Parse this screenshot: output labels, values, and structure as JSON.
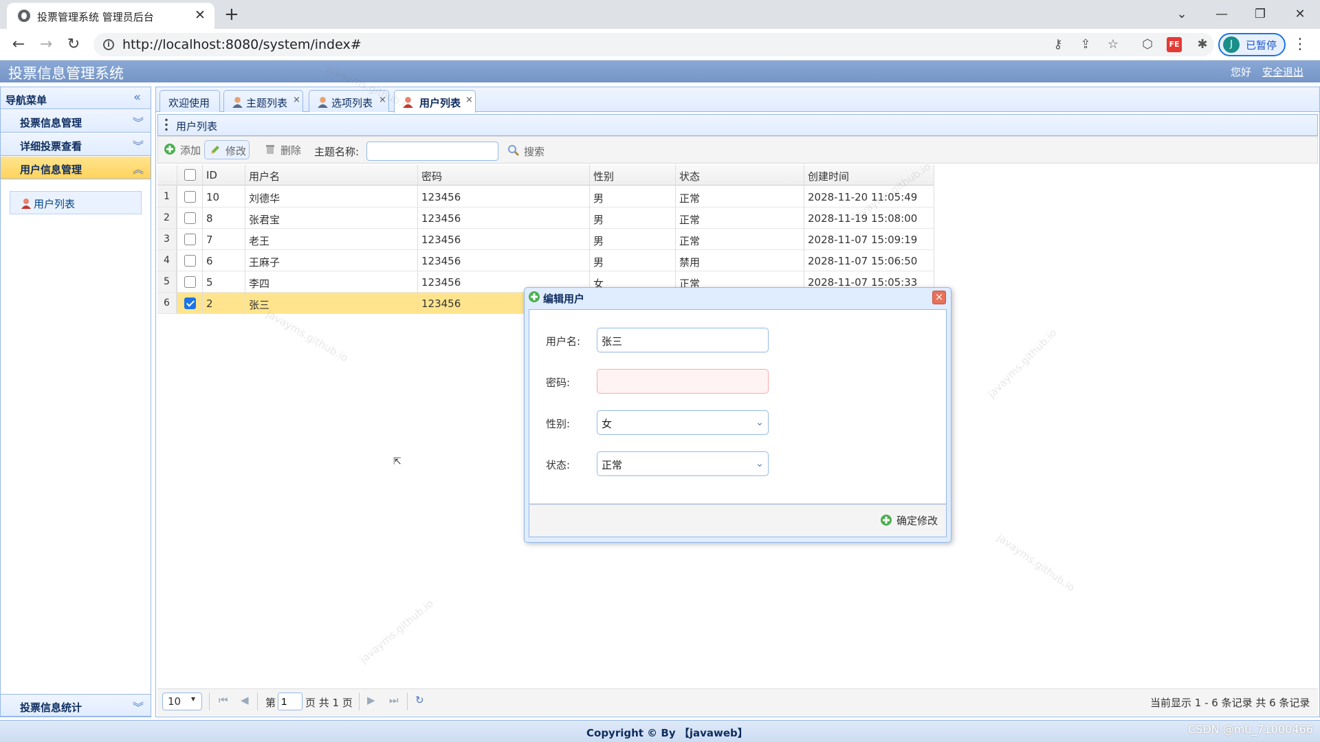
{
  "browser": {
    "tab_title": "投票管理系统 管理员后台",
    "new_tab": "+",
    "tab_close": "✕",
    "url": "http://localhost:8080/system/index#",
    "profile_initial": "J",
    "profile_label": "已暂停",
    "fe_badge": "FE",
    "icons": [
      "key-icon",
      "share-icon",
      "star-icon",
      "extension-icon",
      "fe-extension-icon",
      "puzzle-icon"
    ]
  },
  "app": {
    "title": "投票信息管理系统",
    "greeting": "您好",
    "logout": "安全退出",
    "copyright": "Copyright © By 【javaweb】"
  },
  "sidebar": {
    "heading": "导航菜单",
    "sections": [
      {
        "label": "投票信息管理",
        "expanded": false
      },
      {
        "label": "详细投票查看",
        "expanded": false
      },
      {
        "label": "用户信息管理",
        "expanded": true
      },
      {
        "label": "投票信息统计",
        "expanded": false
      }
    ],
    "active_item": "用户列表"
  },
  "tabs": [
    {
      "label": "欢迎使用",
      "closable": false
    },
    {
      "label": "主题列表",
      "closable": true
    },
    {
      "label": "选项列表",
      "closable": true
    },
    {
      "label": "用户列表",
      "closable": true,
      "selected": true
    }
  ],
  "tab_close_glyph": "×",
  "panel": {
    "title": "用户列表"
  },
  "toolbar": {
    "add": "添加",
    "edit": "修改",
    "delete": "删除",
    "search_label": "主题名称:",
    "search_placeholder": "",
    "search_button": "搜索"
  },
  "grid": {
    "columns": [
      "ID",
      "用户名",
      "密码",
      "性别",
      "状态",
      "创建时间"
    ],
    "rows": [
      {
        "n": "1",
        "id": "10",
        "name": "刘德华",
        "pwd": "123456",
        "sex": "男",
        "status": "正常",
        "created": "2028-11-20 11:05:49",
        "checked": false
      },
      {
        "n": "2",
        "id": "8",
        "name": "张君宝",
        "pwd": "123456",
        "sex": "男",
        "status": "正常",
        "created": "2028-11-19 15:08:00",
        "checked": false
      },
      {
        "n": "3",
        "id": "7",
        "name": "老王",
        "pwd": "123456",
        "sex": "男",
        "status": "正常",
        "created": "2028-11-07 15:09:19",
        "checked": false
      },
      {
        "n": "4",
        "id": "6",
        "name": "王麻子",
        "pwd": "123456",
        "sex": "男",
        "status": "禁用",
        "created": "2028-11-07 15:06:50",
        "checked": false
      },
      {
        "n": "5",
        "id": "5",
        "name": "李四",
        "pwd": "123456",
        "sex": "女",
        "status": "正常",
        "created": "2028-11-07 15:05:33",
        "checked": false
      },
      {
        "n": "6",
        "id": "2",
        "name": "张三",
        "pwd": "123456",
        "sex": "",
        "status": "",
        "created": "",
        "checked": true
      }
    ]
  },
  "pager": {
    "page_size": "10",
    "page_prefix": "第",
    "page_value": "1",
    "page_suffix": "页 共 1 页",
    "info": "当前显示 1 - 6 条记录 共 6 条记录"
  },
  "dialog": {
    "title": "编辑用户",
    "fields": {
      "username_label": "用户名:",
      "username_value": "张三",
      "password_label": "密码:",
      "password_value": "",
      "sex_label": "性别:",
      "sex_value": "女",
      "status_label": "状态:",
      "status_value": "正常"
    },
    "confirm": "确定修改"
  },
  "watermark": "javayms.github.io",
  "csdn": "CSDN @m0_71000466",
  "colors": {
    "accent": "#95b8e7",
    "selected_row": "#ffe48d",
    "header": "#7f9fcf"
  }
}
